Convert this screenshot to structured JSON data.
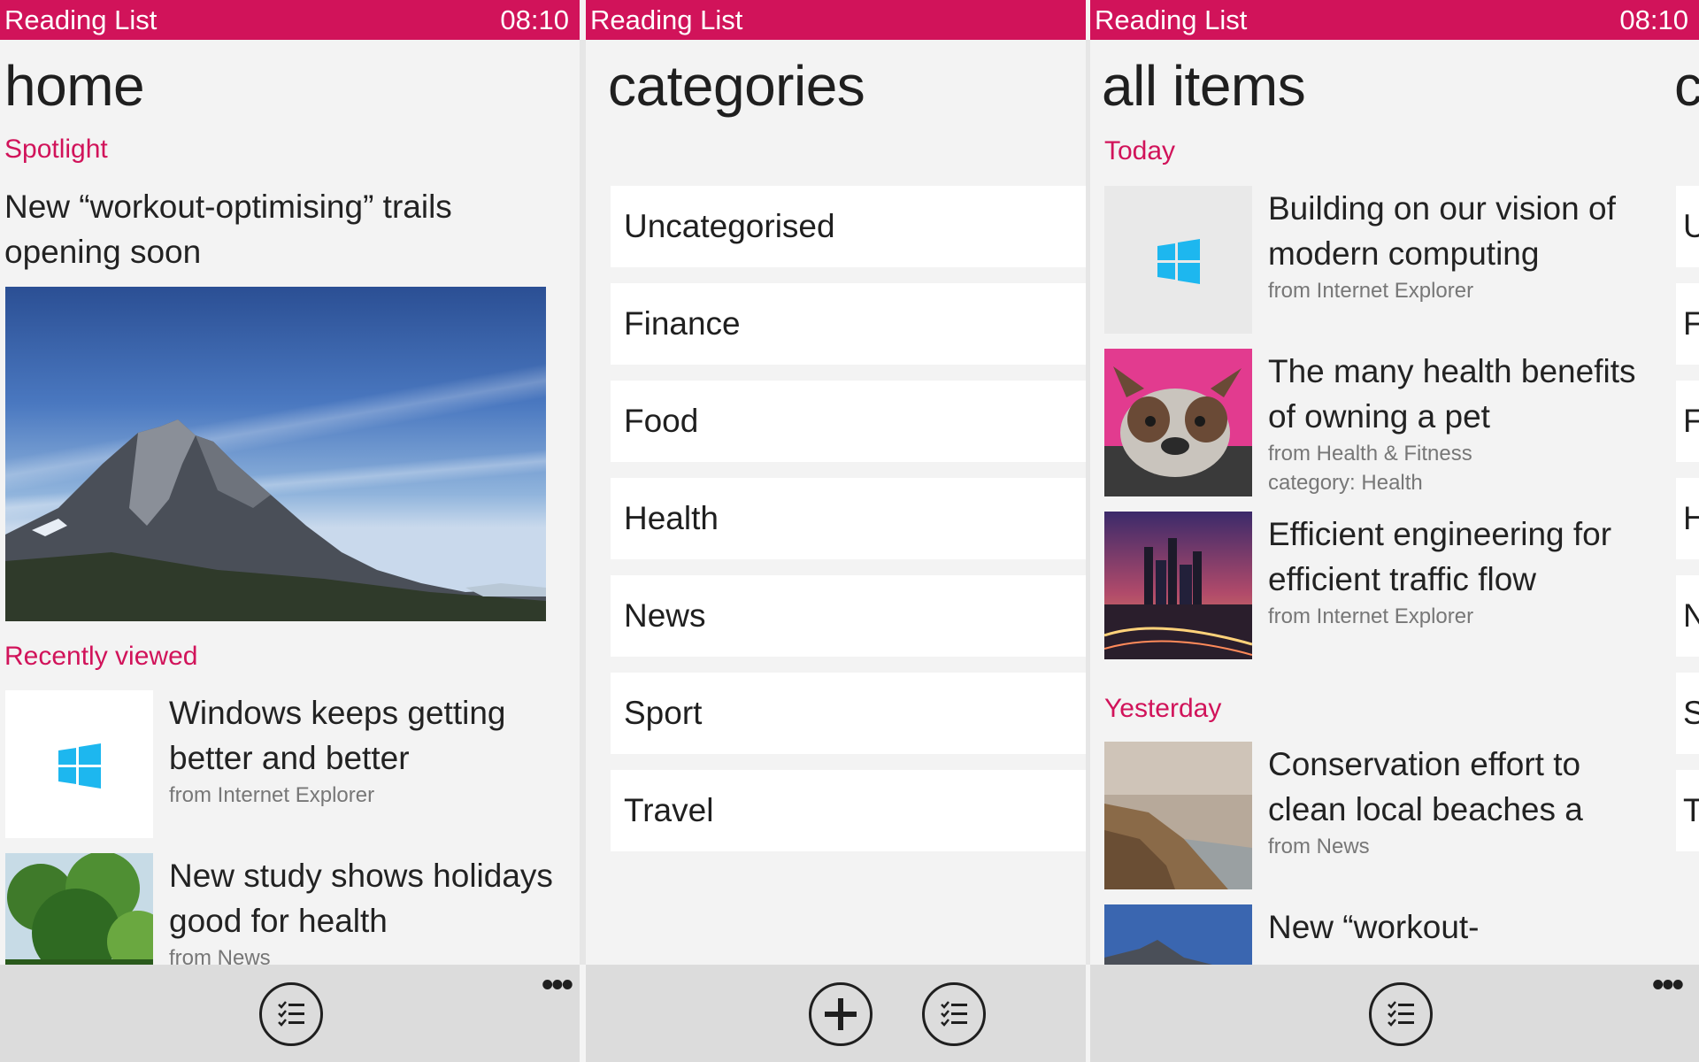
{
  "colors": {
    "accent": "#d1135a",
    "background": "#f3f3f3",
    "tile": "#ffffff",
    "appbar": "#dcdcdc",
    "windows_logo": "#1db7ef"
  },
  "home": {
    "status": {
      "app_name": "Reading List",
      "time": "08:10"
    },
    "title": "home",
    "spotlight": {
      "label": "Spotlight",
      "title": "New “workout-optimising” trails opening soon",
      "image": "mountain-landscape-image"
    },
    "recent": {
      "label": "Recently viewed",
      "items": [
        {
          "title": "Windows keeps getting better and better",
          "source": "from Internet Explorer",
          "thumb": "windows-logo-icon"
        },
        {
          "title": "New study shows holidays good for health",
          "source": "from News",
          "thumb": "palm-trees-image"
        }
      ]
    },
    "appbar": {
      "buttons": [
        "list-icon"
      ],
      "more": "•••"
    }
  },
  "categories": {
    "status": {
      "app_name": "Reading List",
      "time": ""
    },
    "title": "categories",
    "items": [
      "Uncategorised",
      "Finance",
      "Food",
      "Health",
      "News",
      "Sport",
      "Travel"
    ],
    "appbar": {
      "buttons": [
        "add-icon",
        "list-icon"
      ]
    }
  },
  "all_items": {
    "status": {
      "app_name": "Reading List",
      "time": "08:10"
    },
    "title": "all items",
    "next_pivot_peek": "c",
    "peek_tiles": [
      "U",
      "F",
      "F",
      "H",
      "N",
      "S",
      "T"
    ],
    "groups": [
      {
        "label": "Today",
        "items": [
          {
            "title": "Building on our vision of modern computing",
            "source": "from Internet Explorer",
            "category": "",
            "thumb": "windows-logo-icon"
          },
          {
            "title": "The many health benefits of owning a pet",
            "source": "from Health & Fitness",
            "category": "category: Health",
            "thumb": "bulldog-image"
          },
          {
            "title": "Efficient engineering for efficient traffic flow",
            "source": "from Internet Explorer",
            "category": "",
            "thumb": "city-night-image"
          }
        ]
      },
      {
        "label": "Yesterday",
        "items": [
          {
            "title": "Conservation effort to clean local beaches a",
            "source": "from News",
            "category": "",
            "thumb": "coastline-image"
          },
          {
            "title": "New “workout-",
            "source": "",
            "category": "",
            "thumb": "mountain-landscape-image"
          }
        ]
      }
    ],
    "appbar": {
      "buttons": [
        "list-icon"
      ],
      "more": "•••"
    }
  }
}
